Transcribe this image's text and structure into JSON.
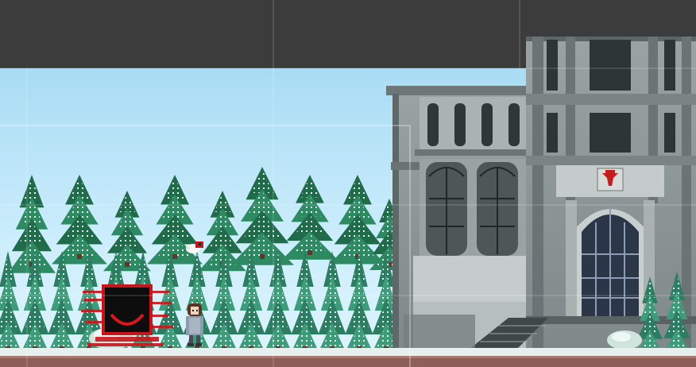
{
  "scene": {
    "type": "2d-pixel-platformer-editor-view",
    "colors": {
      "editor_background": "#3c3c3c",
      "sky": "#b8e4f8",
      "tree_dark": "#1f6b4a",
      "tree_mid": "#2e8a63",
      "snow": "#eef7f6",
      "building_stone": "#8f9898",
      "building_dark": "#4e5859",
      "ground_snow": "#e6f0ee",
      "ground_dirt": "#8e5f58",
      "monster_red": "#c8151c",
      "monster_black": "#0d0d0d"
    },
    "entities": [
      {
        "name": "shadow-monster",
        "icon": "black-box-red-grin"
      },
      {
        "name": "player-girl",
        "icon": "brown-haired-girl-grey-coat"
      },
      {
        "name": "bird",
        "icon": "white-bird-red-wing"
      },
      {
        "name": "mansion",
        "icon": "grey-stone-mansion-red-crest"
      }
    ]
  }
}
